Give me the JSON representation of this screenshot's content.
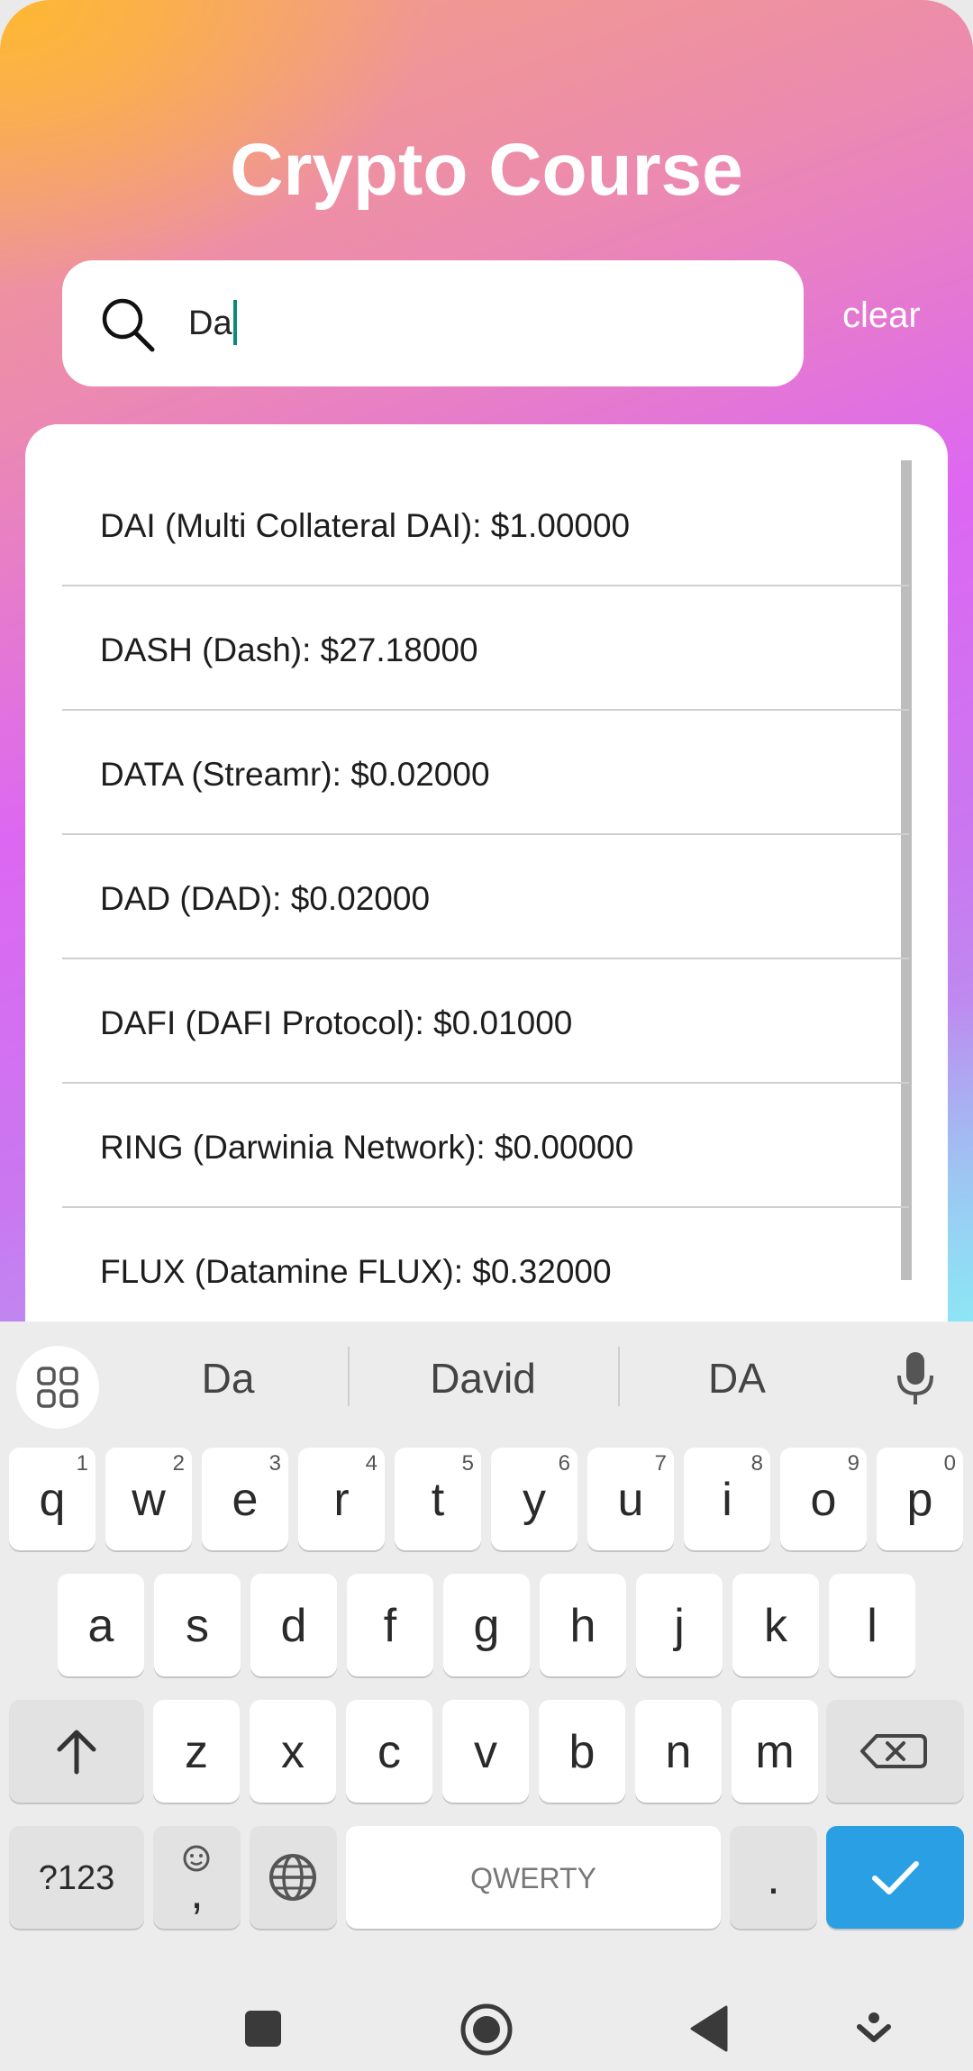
{
  "app": {
    "title": "Crypto Course",
    "search_value": "Da",
    "clear_label": "clear"
  },
  "results": [
    "DAI (Multi Collateral DAI): $1.00000",
    "DASH (Dash): $27.18000",
    "DATA (Streamr): $0.02000",
    "DAD (DAD): $0.02000",
    "DAFI (DAFI Protocol): $0.01000",
    "RING (Darwinia Network): $0.00000",
    "FLUX (Datamine FLUX): $0.32000"
  ],
  "keyboard": {
    "suggestions": [
      "Da",
      "David",
      "DA"
    ],
    "row1": [
      {
        "k": "q",
        "n": "1"
      },
      {
        "k": "w",
        "n": "2"
      },
      {
        "k": "e",
        "n": "3"
      },
      {
        "k": "r",
        "n": "4"
      },
      {
        "k": "t",
        "n": "5"
      },
      {
        "k": "y",
        "n": "6"
      },
      {
        "k": "u",
        "n": "7"
      },
      {
        "k": "i",
        "n": "8"
      },
      {
        "k": "o",
        "n": "9"
      },
      {
        "k": "p",
        "n": "0"
      }
    ],
    "row2": [
      "a",
      "s",
      "d",
      "f",
      "g",
      "h",
      "j",
      "k",
      "l"
    ],
    "row3": [
      "z",
      "x",
      "c",
      "v",
      "b",
      "n",
      "m"
    ],
    "symbols_label": "?123",
    "comma_label": ",",
    "space_label": "QWERTY",
    "period_label": ".",
    "colors": {
      "enter": "#2a9fe4"
    }
  },
  "icons": [
    "search-icon",
    "apps-grid-icon",
    "microphone-icon",
    "shift-icon",
    "backspace-icon",
    "emoji-icon",
    "globe-icon",
    "checkmark-icon",
    "square-icon",
    "home-circle-icon",
    "back-triangle-icon",
    "keyboard-hide-icon"
  ]
}
